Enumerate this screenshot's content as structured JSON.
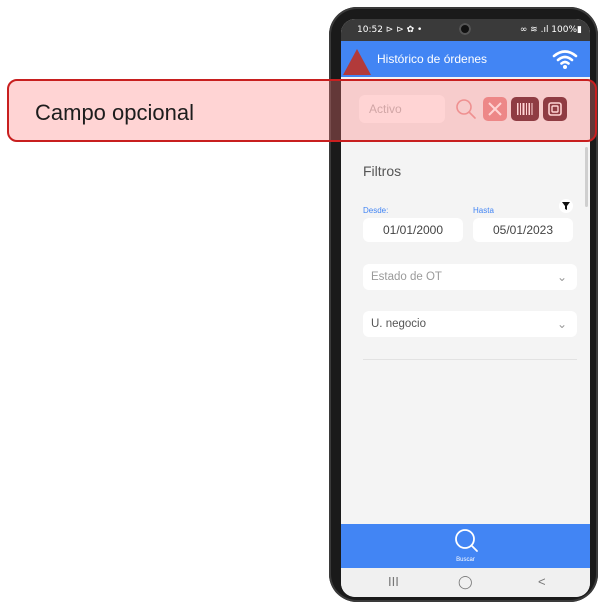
{
  "status_bar": {
    "time": "10:52 ⊳ ⊳ ✿ •",
    "battery": "∞ ≋ .ıl 100%▮"
  },
  "app_header": {
    "title": "Histórico de órdenes"
  },
  "search": {
    "value_placeholder": "Activo"
  },
  "filters": {
    "section_title": "Filtros",
    "desde_label": "Desde:",
    "desde_value": "01/01/2000",
    "hasta_label": "Hasta",
    "hasta_value": "05/01/2023",
    "estado_label": "Estado de OT",
    "negocio_label": "U. negocio"
  },
  "bottom": {
    "search_label": "Buscar"
  },
  "nav": {
    "recent": "III",
    "home": "◯",
    "back": "<"
  },
  "callout": {
    "text": "Campo opcional"
  },
  "colors": {
    "primary": "#4285f4",
    "callout_border": "#c81f1f",
    "callout_fill": "#ff7878",
    "dark_button": "#5b1f2a"
  }
}
